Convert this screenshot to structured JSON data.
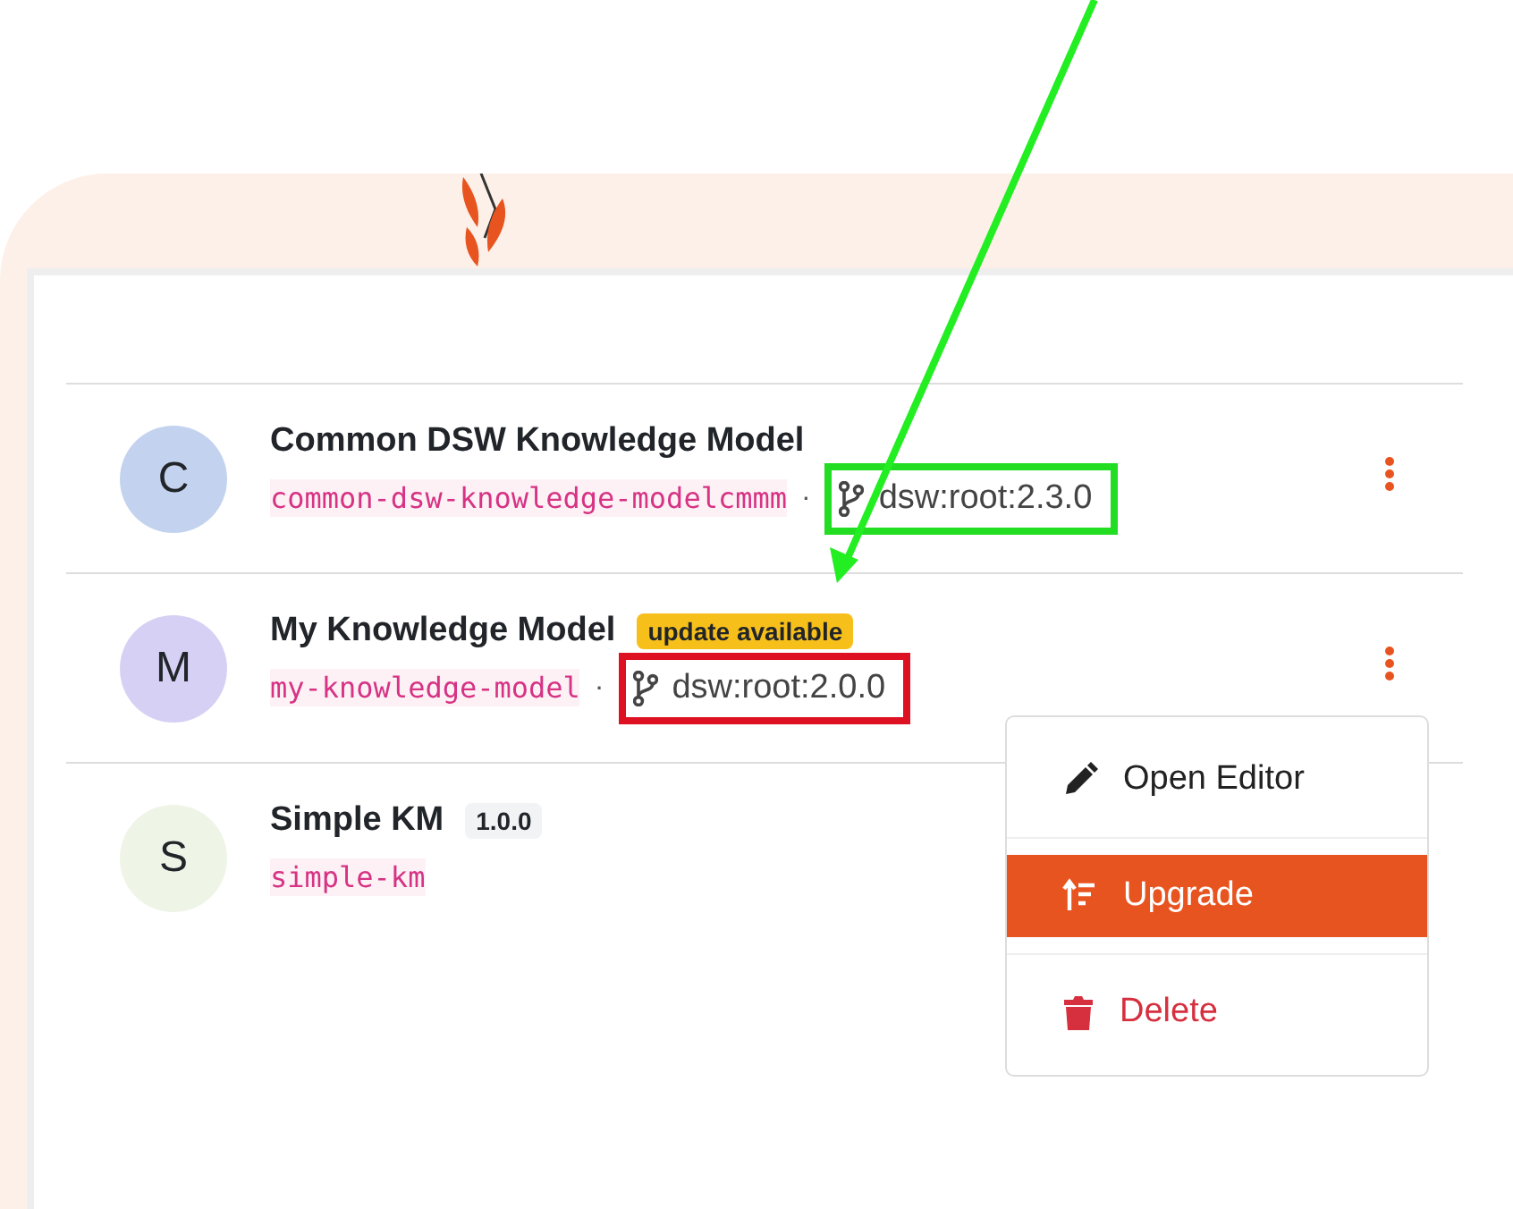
{
  "models": [
    {
      "initial": "C",
      "color": "#c3d3ef",
      "name": "Common DSW Knowledge Model",
      "id": "common-dsw-knowledge-modelcmmm",
      "separator": "·",
      "package": {
        "text": "dsw:root:2.3.0",
        "color": "#22dd22"
      }
    },
    {
      "initial": "M",
      "color": "#d6d0f5",
      "name": "My Knowledge Model",
      "badge": {
        "kind": "warning",
        "text": "update available"
      },
      "id": "my-knowledge-model",
      "separator": "·",
      "package": {
        "text": "dsw:root:2.0.0",
        "color": "#dd1122"
      }
    },
    {
      "initial": "S",
      "color": "#eef4e6",
      "name": "Simple KM",
      "badge": {
        "kind": "version",
        "text": "1.0.0"
      },
      "id": "simple-km"
    }
  ],
  "menu": [
    {
      "kind": "edit",
      "label": "Open Editor",
      "selected": false
    },
    {
      "kind": "upgrade",
      "label": "Upgrade",
      "selected": true
    },
    {
      "kind": "delete",
      "label": "Delete",
      "selected": false
    }
  ]
}
